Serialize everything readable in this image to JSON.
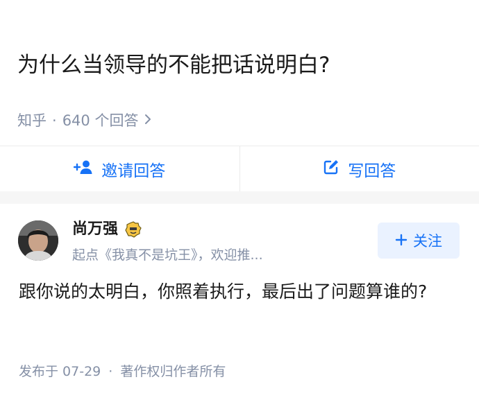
{
  "question": {
    "title": "为什么当领导的不能把话说明白?",
    "source": "知乎",
    "separator": "·",
    "answer_count": "640 个回答",
    "chevron_icon": "chevron-right-icon"
  },
  "actions": {
    "invite_label": "邀请回答",
    "invite_icon": "add-user-icon",
    "write_label": "写回答",
    "write_icon": "edit-icon"
  },
  "answer": {
    "author_name": "尚万强",
    "author_badge_icon": "badge-icon",
    "author_bio": "起点《我真不是坑王》，欢迎推...",
    "follow_label": "关注",
    "follow_icon": "plus-icon",
    "content": "跟你说的太明白，你照着执行，最后出了问题算谁的?",
    "published": "发布于 07-29",
    "separator": "·",
    "copyright": "著作权归作者所有"
  },
  "colors": {
    "accent": "#1772f6",
    "muted": "#8590a6",
    "follow_bg": "#eaf2ff",
    "divider": "#ebebeb",
    "gap_bg": "#f6f6f6"
  }
}
